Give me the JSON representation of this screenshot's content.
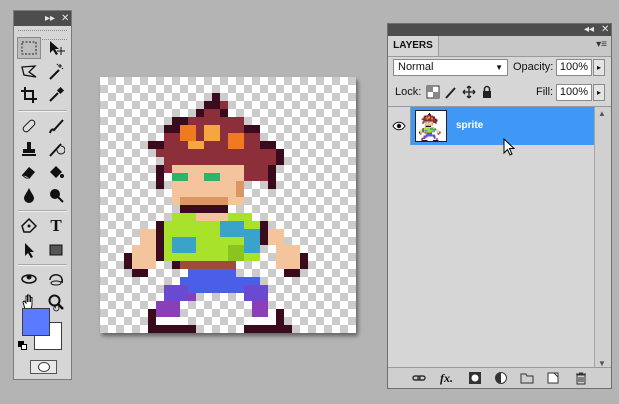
{
  "tools_panel": {
    "titlebar_glyphs": [
      "▸▸",
      "✕"
    ],
    "tools": [
      {
        "name": "rectangular-marquee-tool",
        "icon": "marquee-icon",
        "selected": true
      },
      {
        "name": "move-tool",
        "icon": "move-icon"
      },
      {
        "name": "lasso-tool",
        "icon": "lasso-icon"
      },
      {
        "name": "magic-wand-tool",
        "icon": "magic-wand-icon"
      },
      {
        "name": "crop-tool",
        "icon": "crop-icon"
      },
      {
        "name": "eyedropper-tool",
        "icon": "eyedropper-icon"
      },
      {
        "name": "healing-brush-tool",
        "icon": "bandage-icon"
      },
      {
        "name": "brush-tool",
        "icon": "brush-icon"
      },
      {
        "name": "clone-stamp-tool",
        "icon": "stamp-icon"
      },
      {
        "name": "history-brush-tool",
        "icon": "history-brush-icon"
      },
      {
        "name": "eraser-tool",
        "icon": "eraser-icon"
      },
      {
        "name": "paint-bucket-tool",
        "icon": "bucket-icon"
      },
      {
        "name": "blur-tool",
        "icon": "drop-icon"
      },
      {
        "name": "dodge-tool",
        "icon": "dodge-icon"
      },
      {
        "name": "pen-tool",
        "icon": "pen-icon"
      },
      {
        "name": "type-tool",
        "icon": "type-icon",
        "glyph": "T"
      },
      {
        "name": "path-selection-tool",
        "icon": "arrow-icon"
      },
      {
        "name": "shape-tool",
        "icon": "rectangle-icon"
      },
      {
        "name": "3d-rotate-tool",
        "icon": "3d-rotate-icon"
      },
      {
        "name": "3d-orbit-tool",
        "icon": "3d-orbit-icon"
      },
      {
        "name": "hand-tool",
        "icon": "hand-icon"
      },
      {
        "name": "zoom-tool",
        "icon": "zoom-icon"
      }
    ],
    "foreground_color": "#5a7bff",
    "background_color": "#ffffff"
  },
  "layers_panel": {
    "titlebar_glyphs": [
      "◂◂",
      "✕"
    ],
    "tab_label": "LAYERS",
    "blend_mode": "Normal",
    "opacity_label": "Opacity:",
    "opacity_value": "100%",
    "lock_label": "Lock:",
    "fill_label": "Fill:",
    "fill_value": "100%",
    "layers": [
      {
        "name": "sprite",
        "selected": true,
        "visible": true
      }
    ],
    "footer_icons": [
      "link-icon",
      "fx-icon",
      "mask-icon",
      "adjustment-icon",
      "folder-icon",
      "new-layer-icon",
      "trash-icon"
    ],
    "fx_glyph": "fx.",
    "selection_color": "#3f98f6"
  },
  "canvas": {
    "content": "pixel-art sprite of a spiky-haired boy in a green shirt and blue pants on a transparent background"
  }
}
